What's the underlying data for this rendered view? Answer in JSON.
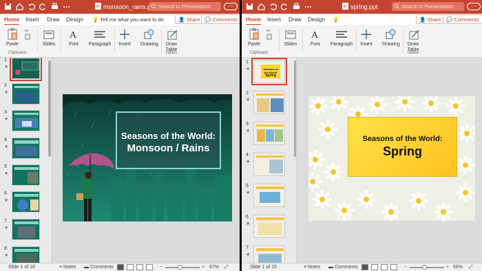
{
  "colors": {
    "accent": "#c4452f",
    "ribbon_bg": "#f3f3f3",
    "slide_green": "#155e50",
    "slide_yellow": "#ffd42e"
  },
  "left": {
    "filename": "monsoon_rains.ppt",
    "search_placeholder": "Search in Presentation",
    "tabs": [
      "Home",
      "Insert",
      "Draw",
      "Design"
    ],
    "tell_me": "Tell me what you want to do",
    "share": "Share",
    "comments": "Comments",
    "ribbon": {
      "paste": "Paste",
      "clipboard": "Clipboard",
      "slides": "Slides",
      "font": "Font",
      "paragraph": "Paragraph",
      "insert": "Insert",
      "drawing": "Drawing",
      "draw_table": "Draw Table",
      "tables": "Tables"
    },
    "thumb_numbers": [
      "1",
      "2",
      "3",
      "4",
      "5",
      "6",
      "7",
      "8"
    ],
    "slide_title_line1": "Seasons of the World:",
    "slide_title_line2": "Monsoon / Rains",
    "status": {
      "slide_info": "Slide 1 of 16",
      "notes": "Notes",
      "comments": "Comments",
      "zoom": "67%"
    }
  },
  "right": {
    "filename": "spring.ppt",
    "search_placeholder": "Search in Presentation",
    "tabs": [
      "Home",
      "Insert",
      "Draw",
      "Design"
    ],
    "share": "Share",
    "comments": "Comments",
    "ribbon": {
      "paste": "Paste",
      "clipboard": "Clipboard",
      "slides": "Slides",
      "font": "Font",
      "paragraph": "Paragraph",
      "insert": "Insert",
      "drawing": "Drawing",
      "draw_table": "Draw Table",
      "tables": "Tables"
    },
    "thumb_numbers": [
      "1",
      "2",
      "3",
      "4",
      "5",
      "6",
      "7"
    ],
    "thumb1_line1": "Seasons of the World",
    "thumb1_line2": "Spring",
    "slide_title_line1": "Seasons of the World:",
    "slide_title_line2": "Spring",
    "status": {
      "slide_info": "Slide 1 of 15",
      "notes": "Notes",
      "comments": "Comments",
      "zoom": "66%"
    }
  }
}
